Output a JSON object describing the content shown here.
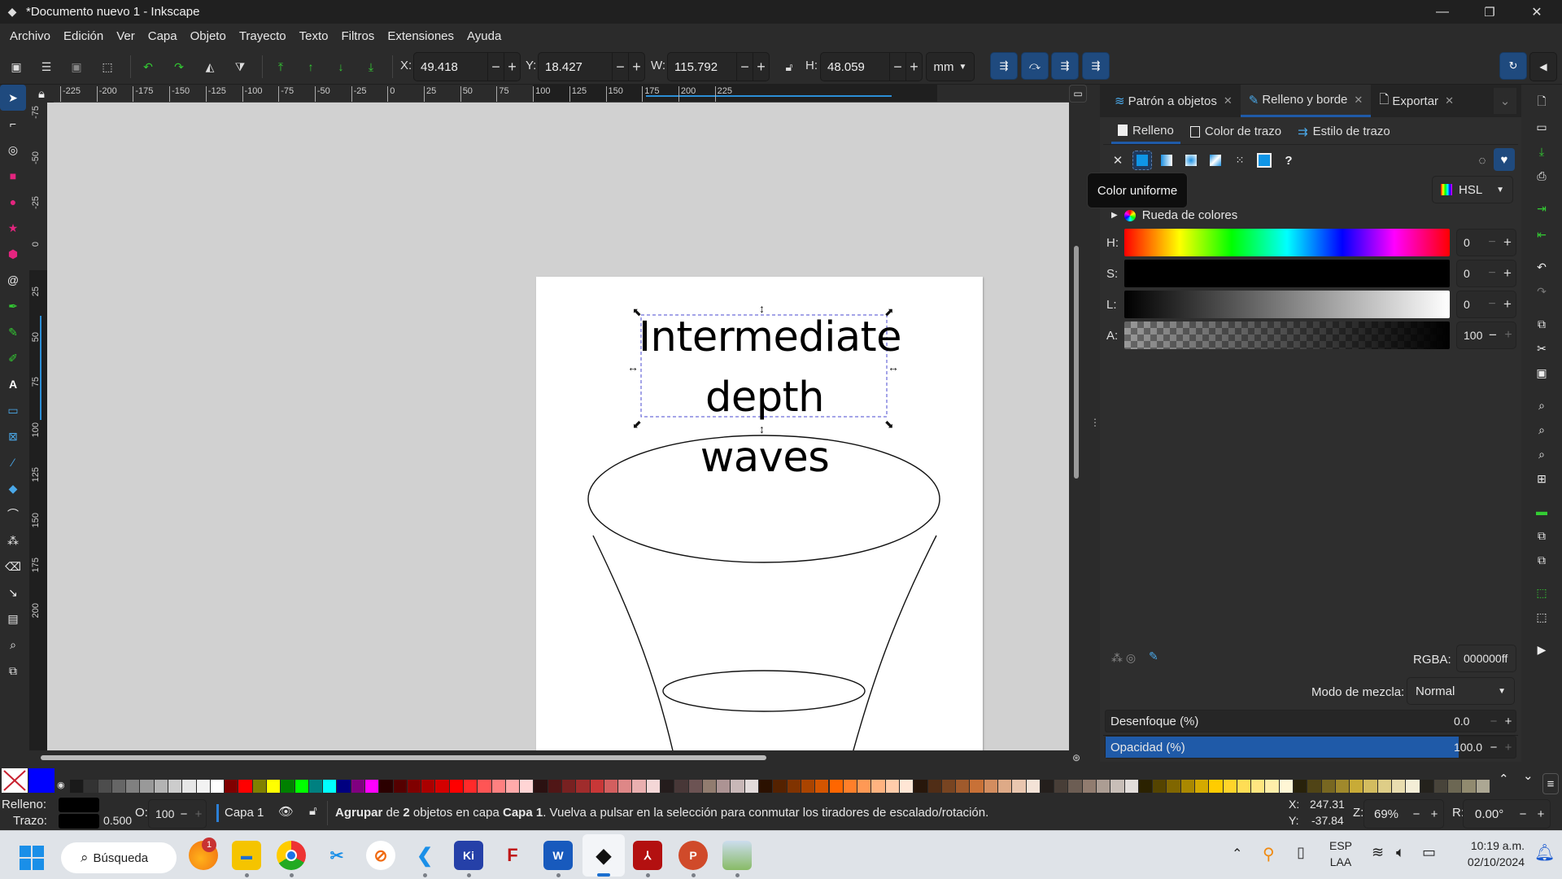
{
  "window": {
    "title": "*Documento nuevo 1 - Inkscape",
    "minimize": "—",
    "maximize": "❐",
    "close": "✕"
  },
  "menu": [
    "Archivo",
    "Edición",
    "Ver",
    "Capa",
    "Objeto",
    "Trayecto",
    "Texto",
    "Filtros",
    "Extensiones",
    "Ayuda"
  ],
  "toolbar": {
    "x_label": "X:",
    "x_value": "49.418",
    "y_label": "Y:",
    "y_value": "18.427",
    "w_label": "W:",
    "w_value": "115.792",
    "h_label": "H:",
    "h_value": "48.059",
    "unit": "mm",
    "minus": "−",
    "plus": "+"
  },
  "rulers": {
    "horizontal": [
      "-225",
      "-200",
      "-175",
      "-150",
      "-125",
      "-100",
      "-75",
      "-50",
      "-25",
      "0",
      "25",
      "50",
      "75",
      "100",
      "125",
      "150",
      "175",
      "200",
      "225"
    ],
    "vertical": [
      "-75",
      "-50",
      "-25",
      "0",
      "25",
      "50",
      "75",
      "100",
      "125",
      "150",
      "175",
      "200"
    ]
  },
  "canvas": {
    "text_line1": "Intermediate",
    "text_line2": "depth waves"
  },
  "dock": {
    "tabs": [
      {
        "label": "Patrón a objetos",
        "active": false
      },
      {
        "label": "Relleno y borde",
        "active": true
      },
      {
        "label": "Exportar",
        "active": false
      }
    ],
    "subtabs": [
      {
        "label": "Relleno",
        "active": true
      },
      {
        "label": "Color de trazo",
        "active": false
      },
      {
        "label": "Estilo de trazo",
        "active": false
      }
    ],
    "tooltip": "Color uniforme",
    "color_mode": "HSL",
    "wheel_label": "Rueda de colores",
    "sliders": [
      {
        "label": "H:",
        "value": "0"
      },
      {
        "label": "S:",
        "value": "0"
      },
      {
        "label": "L:",
        "value": "0"
      },
      {
        "label": "A:",
        "value": "100"
      }
    ],
    "rgba_label": "RGBA:",
    "rgba_value": "000000ff",
    "blend_label": "Modo de mezcla:",
    "blend_value": "Normal",
    "blur_label": "Desenfoque (%)",
    "blur_value": "0.0",
    "opacity_label": "Opacidad (%)",
    "opacity_value": "100.0",
    "accent": "#1f5aa8"
  },
  "palette": {
    "colors": [
      "#1a1a1a",
      "#333333",
      "#4d4d4d",
      "#666666",
      "#808080",
      "#999999",
      "#b3b3b3",
      "#cccccc",
      "#e6e6e6",
      "#f2f2f2",
      "#ffffff",
      "#800000",
      "#ff0000",
      "#808000",
      "#ffff00",
      "#008000",
      "#00ff00",
      "#008080",
      "#00ffff",
      "#000080",
      "#800080",
      "#ff00ff",
      "#2b0000",
      "#550000",
      "#800000",
      "#aa0000",
      "#d40000",
      "#ff0000",
      "#ff2a2a",
      "#ff5555",
      "#ff8080",
      "#ffaaaa",
      "#ffd5d5",
      "#2b1111",
      "#501616",
      "#782121",
      "#a02c2c",
      "#c83737",
      "#d35f5f",
      "#de8787",
      "#e9afaf",
      "#f4d7d7",
      "#241c1c",
      "#483737",
      "#6c5353",
      "#917c6f",
      "#ac9393",
      "#c8b7b7",
      "#e3dbdb",
      "#2b1100",
      "#552200",
      "#803300",
      "#aa4400",
      "#d45500",
      "#ff6600",
      "#ff7f2a",
      "#ff9955",
      "#ffb380",
      "#ffccaa",
      "#ffe6d5",
      "#28170b",
      "#502d16",
      "#784421",
      "#a05a2c",
      "#c87137",
      "#d38d5f",
      "#deaa87",
      "#e9c6af",
      "#f4e3d7",
      "#241f1c",
      "#483e37",
      "#6c5d53",
      "#917c6f",
      "#ac9d93",
      "#c8beb7",
      "#e3dedb",
      "#2b2200",
      "#554400",
      "#806600",
      "#aa8800",
      "#d4aa00",
      "#ffcc00",
      "#ffd42a",
      "#ffdd55",
      "#ffe680",
      "#ffeeaa",
      "#fff6d5",
      "#28220b",
      "#504416",
      "#786721",
      "#a0892c",
      "#c8ab37",
      "#d3bc5f",
      "#decd87",
      "#e9ddaf",
      "#f4eed7",
      "#24221c",
      "#48443a",
      "#6c6753",
      "#918a6f",
      "#aca793"
    ]
  },
  "status": {
    "fill_label": "Relleno:",
    "stroke_label": "Trazo:",
    "stroke_width": "0.500",
    "opacity_label": "O:",
    "opacity_value": "100",
    "layer": "Capa 1",
    "msg_b1": "Agrupar",
    "msg_t1": " de ",
    "msg_b2": "2",
    "msg_t2": " objetos en capa ",
    "msg_b3": "Capa 1",
    "msg_t3": ". Vuelva a pulsar en la selección para conmutar los tiradores de escalado/rotación.",
    "cursor_x_label": "X:",
    "cursor_x": "247.31",
    "cursor_y_label": "Y:",
    "cursor_y": "-37.84",
    "zoom_label": "Z:",
    "zoom_value": "69%",
    "rotation_label": "R:",
    "rotation_value": "0.00°"
  },
  "taskbar": {
    "search_label": "Búsqueda",
    "notification_badge": "1",
    "lang_line1": "ESP",
    "lang_line2": "LAA",
    "time": "10:19 a.m.",
    "date": "02/10/2024"
  }
}
